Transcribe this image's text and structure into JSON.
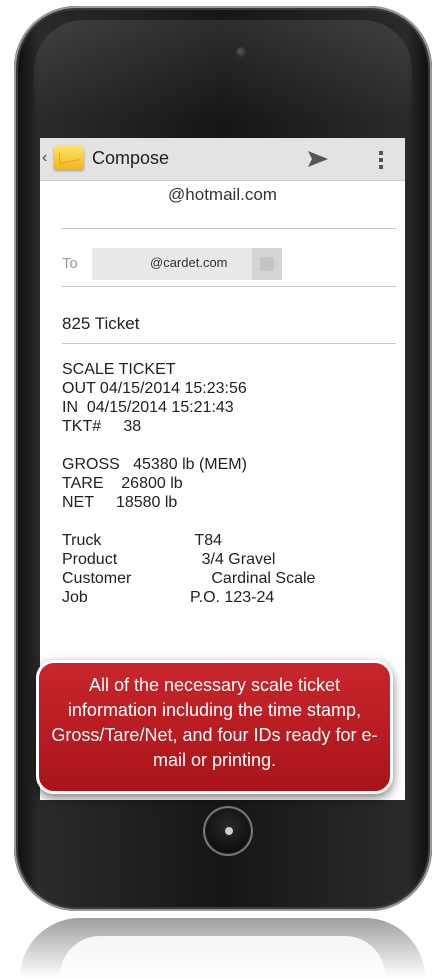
{
  "app_bar": {
    "title": "Compose",
    "icons": [
      "back-chevron-icon",
      "app-icon",
      "send-icon",
      "overflow-menu-icon"
    ]
  },
  "email": {
    "from": "@hotmail.com",
    "to_label": "To",
    "to_recipient": "@cardet.com",
    "subject": "825 Ticket",
    "body_lines": [
      "SCALE TICKET",
      "OUT 04/15/2014 15:23:56",
      "IN  04/15/2014 15:21:43",
      "TKT#     38",
      "",
      "GROSS   45380 lb (MEM)",
      "TARE    26800 lb",
      "NET     18580 lb",
      "",
      "Truck                     T84",
      "Product                   3/4 Gravel",
      "Customer                  Cardinal Scale",
      "Job                       P.O. 123-24"
    ]
  },
  "callout": {
    "text": "All of the necessary scale ticket information including the time stamp, Gross/Tare/Net, and four IDs ready for e-mail or printing."
  },
  "colors": {
    "callout_red": "#b91c21",
    "action_bar": "#e3e3e3",
    "phone_body": "#161616"
  }
}
